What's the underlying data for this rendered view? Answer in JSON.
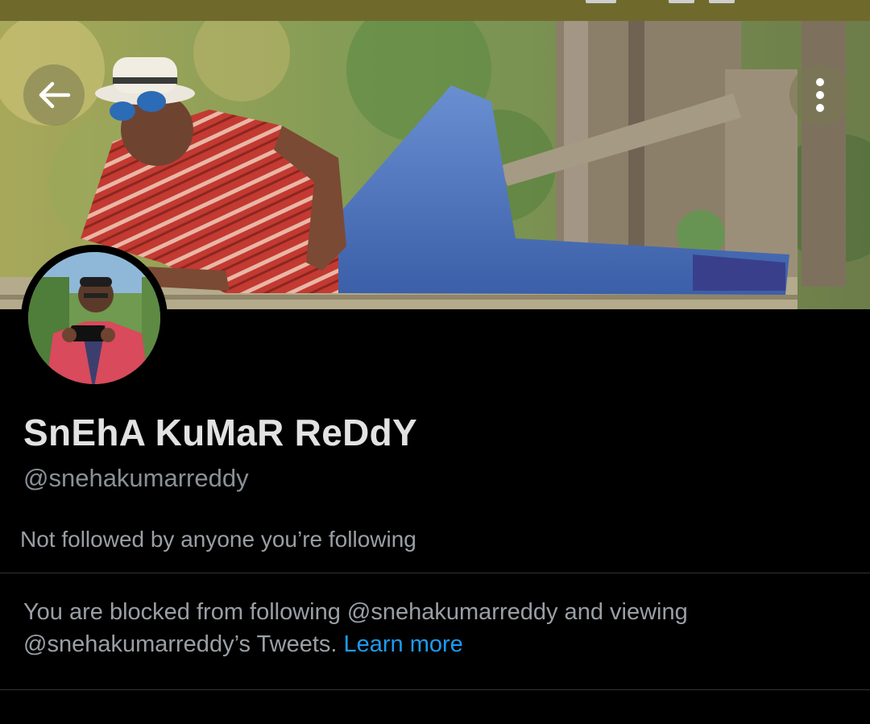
{
  "status_bar": {
    "background_color": "#6f6a2c"
  },
  "header": {
    "back_icon": "arrow-left-icon",
    "more_icon": "vertical-ellipsis-icon"
  },
  "profile": {
    "display_name": "SnEhA KuMaR ReDdY",
    "handle": "@snehakumarreddy",
    "followers_you_know": "Not followed by anyone you’re following"
  },
  "block_notice": {
    "text": "You are blocked from following @snehakumarreddy and viewing @snehakumarreddy’s Tweets.",
    "link_label": "Learn more",
    "link_color": "#1d9bf0"
  },
  "colors": {
    "background": "#000000",
    "primary_text": "#e2e2e2",
    "secondary_text": "#9a9fa5",
    "divider": "#2f3336"
  }
}
